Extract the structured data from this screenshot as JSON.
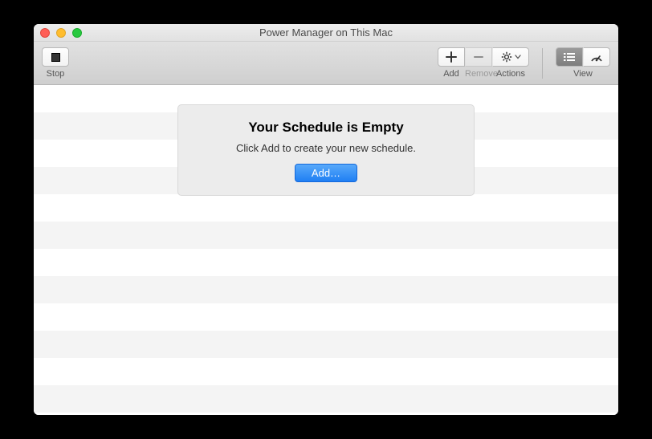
{
  "window": {
    "title": "Power Manager on This Mac"
  },
  "toolbar": {
    "stop_label": "Stop",
    "add_label": "Add",
    "remove_label": "Remove",
    "actions_label": "Actions",
    "view_label": "View"
  },
  "empty_state": {
    "title": "Your Schedule is Empty",
    "subtitle": "Click Add to create your new schedule.",
    "button_label": "Add…"
  }
}
